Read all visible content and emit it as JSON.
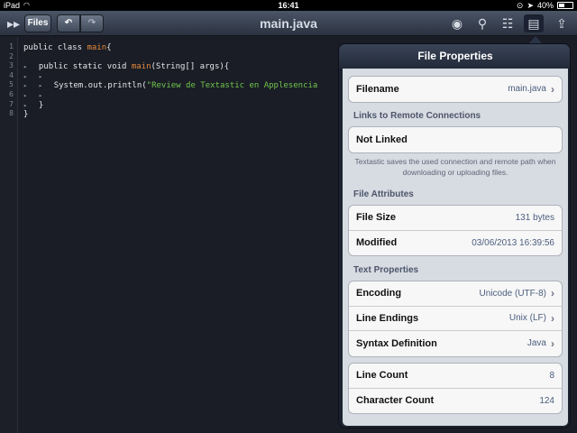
{
  "status_bar": {
    "device": "iPad",
    "time": "16:41",
    "battery": "40%",
    "battery_level": 0.4
  },
  "toolbar": {
    "files_label": "Files",
    "title": "main.java"
  },
  "editor": {
    "line_numbers": [
      "1",
      "2",
      "3",
      "4",
      "5",
      "6",
      "7",
      "8"
    ],
    "lines": [
      {
        "parts": [
          {
            "t": "public class ",
            "c": "kw"
          },
          {
            "t": "main",
            "c": "cls"
          },
          {
            "t": "{",
            "c": "kw"
          }
        ]
      },
      {
        "parts": []
      },
      {
        "parts": [
          {
            "t": "▸   ",
            "c": "tri"
          },
          {
            "t": "public static void ",
            "c": "kw"
          },
          {
            "t": "main",
            "c": "cls"
          },
          {
            "t": "(String[] args){",
            "c": "kw"
          }
        ]
      },
      {
        "parts": [
          {
            "t": "▸   ▸",
            "c": "tri"
          }
        ]
      },
      {
        "parts": [
          {
            "t": "▸   ▸   ",
            "c": "tri"
          },
          {
            "t": "System.out.println(",
            "c": "kw"
          },
          {
            "t": "\"Review de Textastic en Applesencia",
            "c": "str"
          }
        ]
      },
      {
        "parts": [
          {
            "t": "▸   ▸",
            "c": "tri"
          }
        ]
      },
      {
        "parts": [
          {
            "t": "▸   ",
            "c": "tri"
          },
          {
            "t": "}",
            "c": "kw"
          }
        ]
      },
      {
        "parts": [
          {
            "t": "}",
            "c": "kw"
          }
        ]
      }
    ]
  },
  "popover": {
    "title": "File Properties",
    "filename_label": "Filename",
    "filename_value": "main.java",
    "links_header": "Links to Remote Connections",
    "not_linked": "Not Linked",
    "links_note": "Textastic saves the used connection and remote path when downloading or uploading files.",
    "attributes_header": "File Attributes",
    "file_size_label": "File Size",
    "file_size_value": "131 bytes",
    "modified_label": "Modified",
    "modified_value": "03/06/2013 16:39:56",
    "text_header": "Text Properties",
    "encoding_label": "Encoding",
    "encoding_value": "Unicode (UTF-8)",
    "line_endings_label": "Line Endings",
    "line_endings_value": "Unix (LF)",
    "syntax_label": "Syntax Definition",
    "syntax_value": "Java",
    "line_count_label": "Line Count",
    "line_count_value": "8",
    "char_count_label": "Character Count",
    "char_count_value": "124"
  }
}
